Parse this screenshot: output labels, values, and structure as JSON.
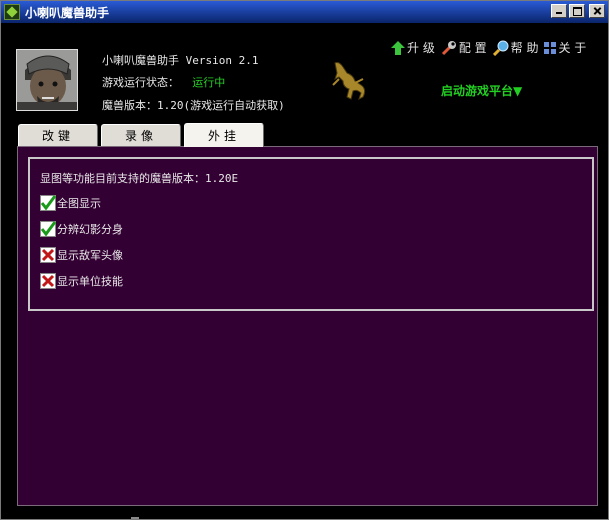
{
  "window": {
    "title": "小喇叭魔兽助手"
  },
  "header": {
    "app_name": "小喇叭魔兽助手 Version 2.1",
    "status_label": "游戏运行状态：",
    "status_value": "运行中",
    "version_text": "魔兽版本：1.20(游戏运行自动获取)"
  },
  "toolbar": {
    "upgrade": "升 级",
    "config": "配 置",
    "help": "帮 助",
    "about": "关 于"
  },
  "launch_platform": "启动游戏平台▼",
  "tabs": [
    {
      "label": "改键",
      "active": false
    },
    {
      "label": "录像",
      "active": false
    },
    {
      "label": "外挂",
      "active": true
    }
  ],
  "plugin": {
    "support_text": "显图等功能目前支持的魔兽版本：1.20E",
    "options": [
      {
        "label": "全图显示",
        "checked": true
      },
      {
        "label": "分辨幻影分身",
        "checked": true
      },
      {
        "label": "显示敌军头像",
        "checked": false
      },
      {
        "label": "显示单位技能",
        "checked": false
      }
    ]
  },
  "colors": {
    "status_green": "#26d026",
    "panel_purple": "#330033"
  },
  "icons": [
    "warcraft-app-icon",
    "up-arrow-icon",
    "wrench-icon",
    "magnifier-icon",
    "grid-icon",
    "lizard-icon"
  ]
}
